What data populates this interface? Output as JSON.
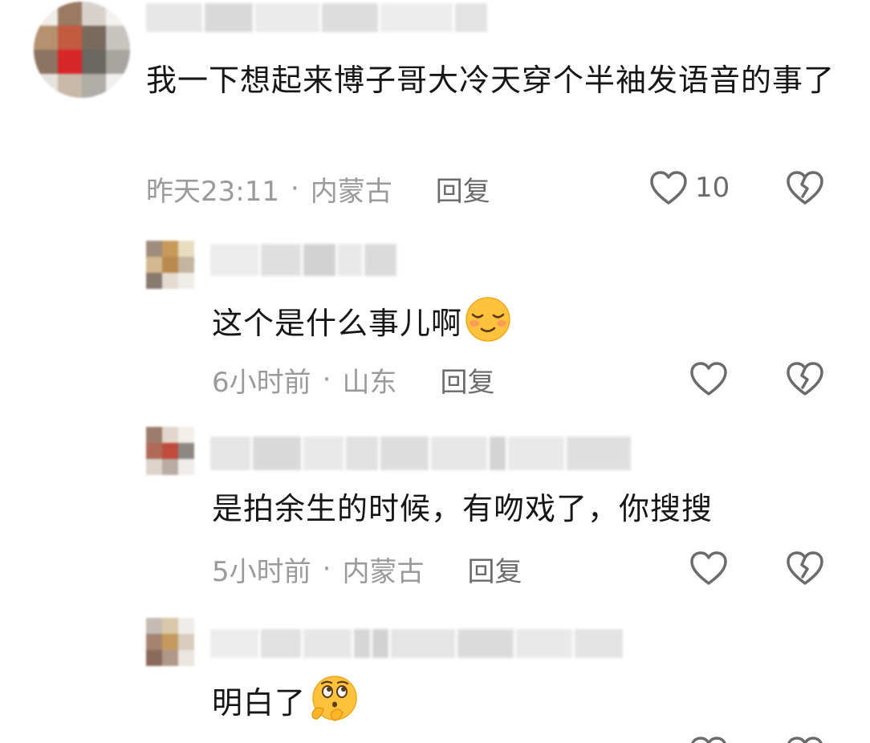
{
  "comments": [
    {
      "text": "我一下想起来博子哥大冷天穿个半袖发语音的事了",
      "time": "昨天23:11",
      "location": "内蒙古",
      "reply_label": "回复",
      "like_count": "10"
    },
    {
      "text": "这个是什么事儿啊",
      "time": "6小时前",
      "location": "山东",
      "reply_label": "回复",
      "like_count": "",
      "emoji": "smiling-closed-eyes-emoji"
    },
    {
      "text": "是拍余生的时候，有吻戏了，你搜搜",
      "time": "5小时前",
      "location": "内蒙古",
      "reply_label": "回复",
      "like_count": ""
    },
    {
      "text": "明白了",
      "emoji": "thinking-hands-emoji"
    }
  ],
  "separator": "·",
  "colors": {
    "text": "#161616",
    "meta": "#9a9a9a",
    "action": "#6b6b6b",
    "emoji_yellow": "#ffc23d"
  }
}
